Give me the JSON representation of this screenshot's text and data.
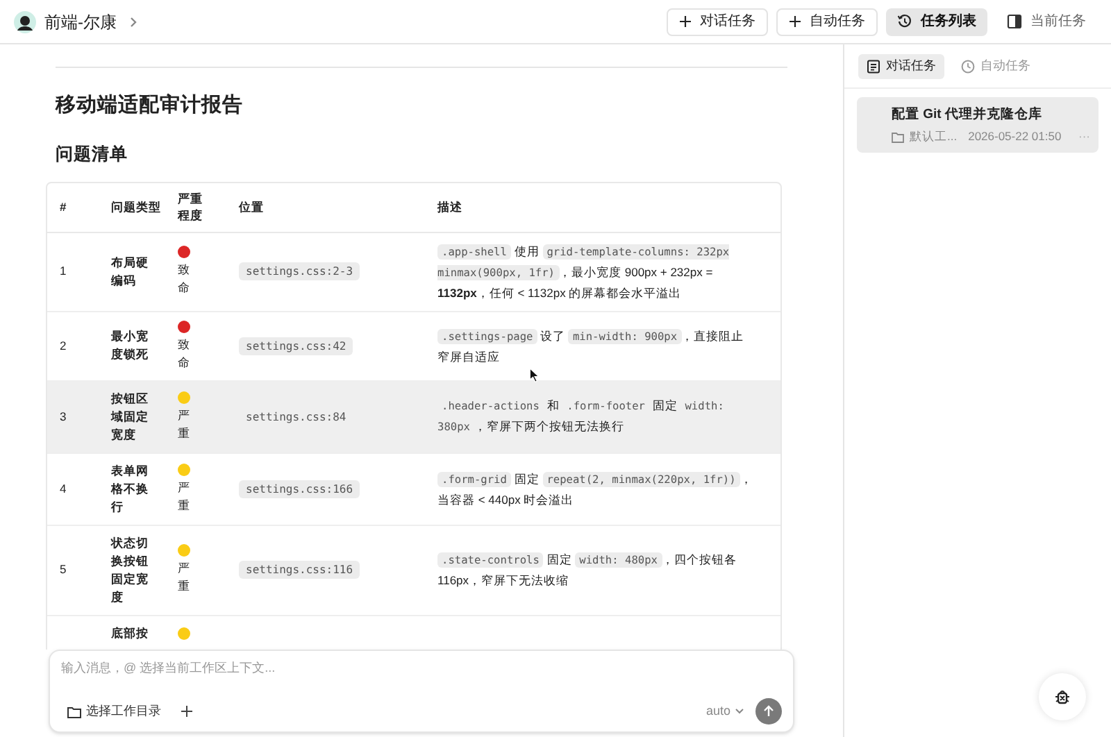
{
  "header": {
    "workspace": "前端-尔康",
    "actions": [
      {
        "label": "对话任务",
        "kind": "create"
      },
      {
        "label": "自动任务",
        "kind": "create"
      },
      {
        "label": "任务列表",
        "kind": "view",
        "selected": true
      },
      {
        "label": "当前任务",
        "kind": "view",
        "selected": false
      }
    ]
  },
  "report": {
    "title": "移动端适配审计报告",
    "section": "问题清单",
    "table": {
      "columns": [
        "#",
        "问题类型",
        "严重程度",
        "位置",
        "描述"
      ],
      "rows": [
        {
          "num": "1",
          "type": "布局硬编码",
          "severity": "致命",
          "color": "#dc2626",
          "location": "settings.css:2-3",
          "highlighted": false,
          "description": [
            {
              "kind": "code",
              "text": ".app-shell"
            },
            {
              "kind": "text",
              "text": " 使用 "
            },
            {
              "kind": "code",
              "text": "grid-template-columns: 232px minmax(900px, 1fr)"
            },
            {
              "kind": "text",
              "text": "，最小宽度 900px + 232px = **1132px**，任何 < 1132px 的屏幕都会水平溢出"
            }
          ]
        },
        {
          "num": "2",
          "type": "最小宽度锁死",
          "severity": "致命",
          "color": "#dc2626",
          "location": "settings.css:42",
          "highlighted": false,
          "description": [
            {
              "kind": "code",
              "text": ".settings-page"
            },
            {
              "kind": "text",
              "text": " 设了 "
            },
            {
              "kind": "code",
              "text": "min-width: 900px"
            },
            {
              "kind": "text",
              "text": "，直接阻止窄屏自适应"
            }
          ]
        },
        {
          "num": "3",
          "type": "按钮区域固定宽度",
          "severity": "严重",
          "color": "#facc15",
          "location": "settings.css:84",
          "highlighted": true,
          "description": [
            {
              "kind": "code",
              "text": ".header-actions"
            },
            {
              "kind": "text",
              "text": " 和 "
            },
            {
              "kind": "code",
              "text": ".form-footer"
            },
            {
              "kind": "text",
              "text": " 固定 "
            },
            {
              "kind": "code",
              "text": "width: 380px"
            },
            {
              "kind": "text",
              "text": "，窄屏下两个按钮无法换行"
            }
          ]
        },
        {
          "num": "4",
          "type": "表单网格不换行",
          "severity": "严重",
          "color": "#facc15",
          "location": "settings.css:166",
          "highlighted": false,
          "description": [
            {
              "kind": "code",
              "text": ".form-grid"
            },
            {
              "kind": "text",
              "text": " 固定 "
            },
            {
              "kind": "code",
              "text": "repeat(2, minmax(220px, 1fr))"
            },
            {
              "kind": "text",
              "text": "，当容器 < 440px 时会溢出"
            }
          ]
        },
        {
          "num": "5",
          "type": "状态切换按钮固定宽度",
          "severity": "严重",
          "color": "#facc15",
          "location": "settings.css:116",
          "highlighted": false,
          "description": [
            {
              "kind": "code",
              "text": ".state-controls"
            },
            {
              "kind": "text",
              "text": " 固定 "
            },
            {
              "kind": "code",
              "text": "width: 480px"
            },
            {
              "kind": "text",
              "text": "，四个按钮各 116px，窄屏下无法收缩"
            }
          ]
        },
        {
          "type": "底部按",
          "color": "#facc15",
          "highlighted": false
        }
      ]
    }
  },
  "composer": {
    "placeholder": "输入消息，@ 选择当前工作区上下文...",
    "workdir": "选择工作目录",
    "model": "auto"
  },
  "sidebar": {
    "tabs": [
      {
        "label": "对话任务",
        "selected": true
      },
      {
        "label": "自动任务",
        "selected": false
      }
    ],
    "tasks": [
      {
        "title": "配置 Git 代理并克隆仓库",
        "folder": "默认工...",
        "time": "2026-05-22 01:50",
        "more": "···"
      }
    ]
  }
}
